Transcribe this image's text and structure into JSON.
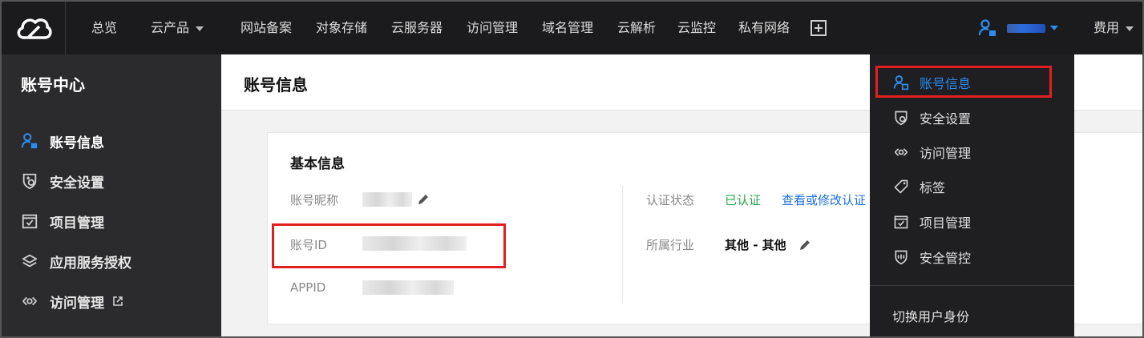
{
  "topbar": {
    "logo_icon": "cloud-logo-icon",
    "nav": [
      {
        "label": "总览"
      },
      {
        "label": "云产品"
      },
      {
        "label": "网站备案"
      },
      {
        "label": "对象存储"
      },
      {
        "label": "云服务器"
      },
      {
        "label": "访问管理"
      },
      {
        "label": "域名管理"
      },
      {
        "label": "云解析"
      },
      {
        "label": "云监控"
      },
      {
        "label": "私有网络"
      }
    ],
    "more_icon": "plus-box-icon",
    "billing_label": "费用",
    "accent_color": "#2d8cf0"
  },
  "sidebar": {
    "title": "账号中心",
    "items": [
      {
        "label": "账号信息",
        "icon": "account-icon",
        "active": true
      },
      {
        "label": "安全设置",
        "icon": "shield-icon"
      },
      {
        "label": "项目管理",
        "icon": "project-icon"
      },
      {
        "label": "应用服务授权",
        "icon": "layers-icon"
      },
      {
        "label": "访问管理",
        "icon": "access-icon",
        "external_icon": "external-link-icon"
      }
    ]
  },
  "main": {
    "page_title": "账号信息",
    "card": {
      "title": "基本信息",
      "fields_left": [
        {
          "label": "账号昵称"
        },
        {
          "label": "账号ID"
        },
        {
          "label": "APPID"
        }
      ],
      "fields_right": [
        {
          "label": "认证状态",
          "value": "已认证",
          "link": "查看或修改认证"
        },
        {
          "label": "所属行业",
          "value": "其他 - 其他"
        }
      ]
    }
  },
  "dropdown": {
    "items": [
      {
        "label": "账号信息",
        "icon": "account-icon",
        "active": true
      },
      {
        "label": "安全设置",
        "icon": "shield-icon"
      },
      {
        "label": "访问管理",
        "icon": "access-icon"
      },
      {
        "label": "标签",
        "icon": "tag-icon"
      },
      {
        "label": "项目管理",
        "icon": "project-icon"
      },
      {
        "label": "安全管控",
        "icon": "security-control-icon"
      }
    ],
    "footer": "切换用户身份"
  },
  "colors": {
    "highlight": "#e02020",
    "success": "#29a84a",
    "link": "#1d6fe0"
  }
}
